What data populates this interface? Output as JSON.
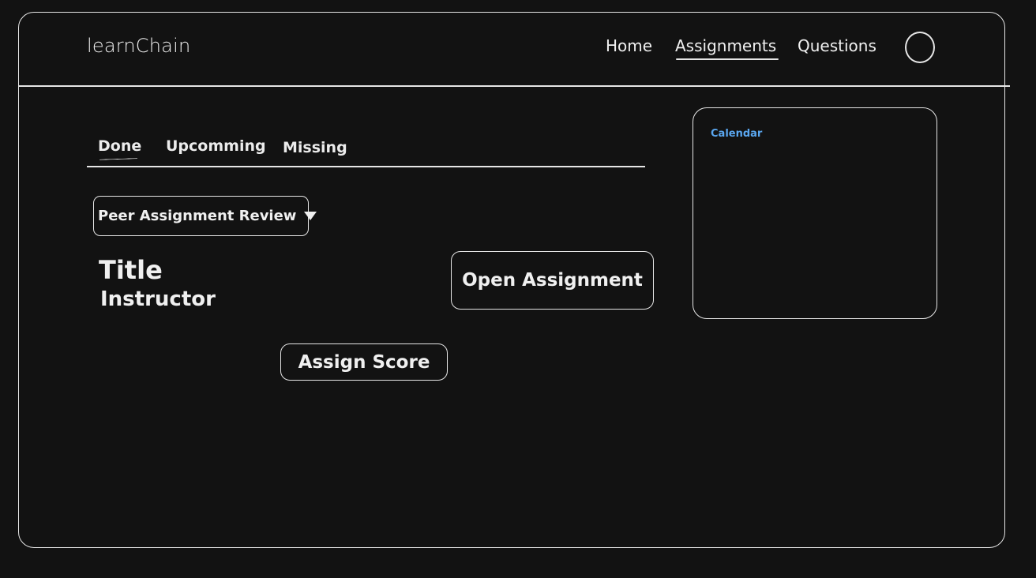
{
  "header": {
    "logo": "learnChain",
    "nav": {
      "home": "Home",
      "assignments": "Assignments",
      "questions": "Questions"
    },
    "active_nav": "Assignments"
  },
  "tabs": {
    "items": [
      "Done",
      "Upcomming",
      "Missing"
    ],
    "active": "Done"
  },
  "filter": {
    "selected": "Peer Assignment Review"
  },
  "assignment": {
    "title": "Title",
    "instructor": "Instructor",
    "open_button": "Open Assignment",
    "score_button": "Assign Score"
  },
  "calendar": {
    "label": "Calendar",
    "label_color": "#5aa7f0"
  },
  "colors": {
    "background": "#121212",
    "stroke": "#e6e6e6",
    "text": "#f0f0f0",
    "accent": "#5aa7f0"
  }
}
